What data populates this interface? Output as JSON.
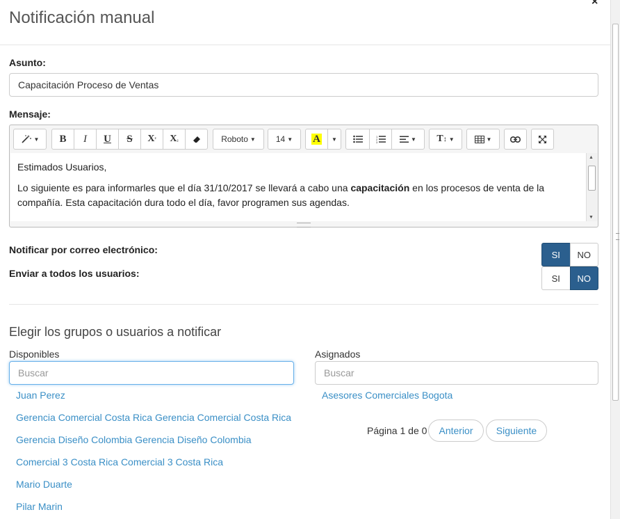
{
  "modal": {
    "title": "Notificación manual",
    "close_glyph": "×"
  },
  "subject": {
    "label": "Asunto:",
    "value": "Capacitación Proceso de Ventas"
  },
  "message": {
    "label": "Mensaje:",
    "toolbar": {
      "font_family": "Roboto",
      "font_size": "14",
      "icons": [
        "magic-wand-icon",
        "bold-icon",
        "italic-icon",
        "underline-icon",
        "strikethrough-icon",
        "superscript-icon",
        "subscript-icon",
        "eraser-icon",
        "font-color-icon",
        "unordered-list-icon",
        "ordered-list-icon",
        "align-icon",
        "line-height-icon",
        "table-icon",
        "link-icon",
        "fullscreen-icon"
      ]
    },
    "body": {
      "line1": "Estimados Usuarios,",
      "line2_before": "Lo siguiente es para informarles que el día 31/10/2017 se llevará a cabo una ",
      "line2_bold": "capacitación",
      "line2_after": " en los procesos de venta de la compañía. Esta capacitación dura todo el día, favor programen sus agendas."
    }
  },
  "notify_email": {
    "label": "Notificar por correo electrónico:",
    "yes": "SI",
    "no": "NO",
    "selected": "SI"
  },
  "send_all": {
    "label": "Enviar a todos los usuarios:",
    "yes": "SI",
    "no": "NO",
    "selected": "NO"
  },
  "groups": {
    "title": "Elegir los grupos o usuarios a notificar",
    "available": {
      "header": "Disponibles",
      "search_placeholder": "Buscar",
      "items": [
        "Juan Perez",
        "Gerencia Comercial Costa Rica Gerencia Comercial Costa Rica",
        "Gerencia Diseño Colombia Gerencia Diseño Colombia",
        "Comercial 3 Costa Rica Comercial 3 Costa Rica",
        "Mario Duarte",
        "Pilar Marin"
      ]
    },
    "assigned": {
      "header": "Asignados",
      "search_placeholder": "Buscar",
      "items": [
        "Asesores Comerciales Bogota"
      ],
      "pager": {
        "text": "Página 1 de 0",
        "prev": "Anterior",
        "next": "Siguiente"
      }
    }
  },
  "colors": {
    "accent": "#2b5f8e",
    "link": "#3a8fc6",
    "highlight": "#ffff00"
  }
}
